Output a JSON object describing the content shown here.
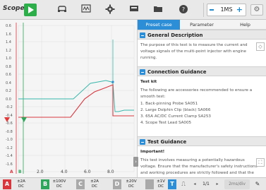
{
  "toolbar": {
    "brand": "Scope",
    "time_value": "1MS",
    "icons": [
      "play-icon",
      "car-icon",
      "scope-icon",
      "gear-icon",
      "record-icon",
      "folder-icon",
      "help-icon",
      "settings-icon"
    ]
  },
  "scope": {
    "y_ticks": [
      "0.6",
      "1.6",
      "1.4",
      "1.2",
      "1.0",
      "0.8",
      "0.6",
      "0.4",
      "0.2",
      "0.0",
      "-0.2",
      "-0.4",
      "-0.6",
      "-0.8",
      "-1.0",
      "-1.2",
      "-1.4",
      "-1.6"
    ],
    "x_ticks": [
      "2.0",
      "4.0",
      "6.0",
      "8.0"
    ],
    "channel_marks": [
      "A",
      "B"
    ],
    "colors": {
      "trace_red": "#d9363e",
      "trace_cyan": "#38b7ab",
      "marker_red": "#e23a3a",
      "marker_green": "#2ea55b"
    }
  },
  "panel": {
    "tabs": [
      "Preset case",
      "Parameter",
      "Help"
    ],
    "active_tab": "Preset case",
    "sections": [
      {
        "title": "General Description",
        "text": "The purpose of this test is to measure the current and voltage signals of the multi-point injector with engine running."
      },
      {
        "title": "Connection Guidance",
        "subtitle": "Test kit",
        "intro": "The following are accessories recommended to ensure a smooth test:",
        "items": [
          "1. Back-pinning Probe SA051",
          "2. Large Dolphin Clip (black) SA066",
          "3. 65A AC/DC Current Clamp SA253",
          "4. Scope Test Lead SA005"
        ]
      },
      {
        "title": "Test Guidance",
        "subtitle": "Important!",
        "text": "This test involves measuring a potentially hazardous voltage. Ensure that the manufacturer's safety instructions and working procedures are strictly followed and that the rated values of the"
      }
    ]
  },
  "bottom": {
    "channels": [
      {
        "id": "A",
        "color": "#d9363e",
        "range": "±2A",
        "coupling": "DC"
      },
      {
        "id": "B",
        "color": "#2ea55b",
        "range": "±100V",
        "coupling": "DC"
      },
      {
        "id": "C",
        "color": "#a9a9a9",
        "range": "±2A",
        "coupling": "DC"
      },
      {
        "id": "D",
        "color": "#a9a9a9",
        "range": "±20V",
        "coupling": "DC"
      },
      {
        "id": "",
        "color": "#a9a9a9",
        "range": "±1V",
        "coupling": "DC"
      }
    ],
    "t_label": "T",
    "page": "1/1",
    "timebase": "2ms/div"
  }
}
